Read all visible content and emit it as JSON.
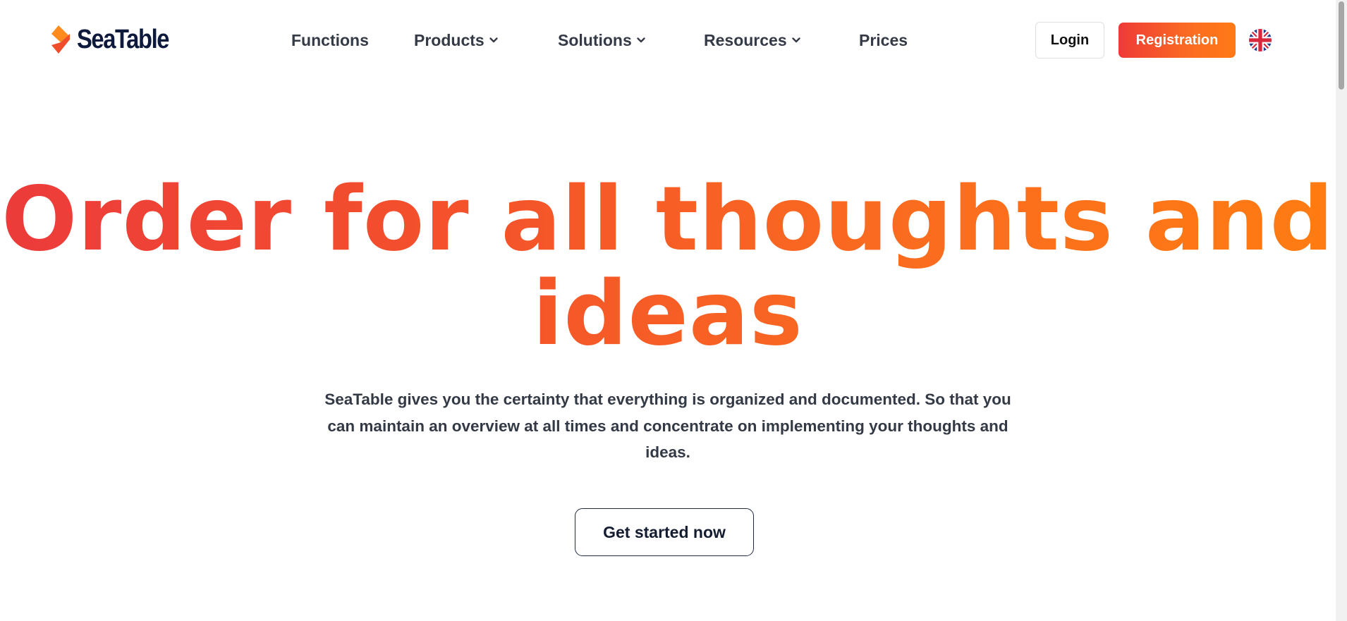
{
  "brand": {
    "name": "SeaTable",
    "colors": {
      "primary_gradient_start": "#ef3a36",
      "primary_gradient_end": "#ff7a16",
      "navy": "#0e1a3c",
      "text": "#343a46"
    }
  },
  "nav": {
    "items": [
      {
        "label": "Functions",
        "has_dropdown": false
      },
      {
        "label": "Products",
        "has_dropdown": true
      },
      {
        "label": "Solutions",
        "has_dropdown": true
      },
      {
        "label": "Resources",
        "has_dropdown": true
      },
      {
        "label": "Prices",
        "has_dropdown": false
      }
    ],
    "dropdown_icon": "chevron-down-icon"
  },
  "header_actions": {
    "login_label": "Login",
    "register_label": "Registration",
    "language_icon": "uk-flag-icon"
  },
  "hero": {
    "title_line1": "Order for all thoughts and",
    "title_line2": "ideas",
    "subtitle": "SeaTable gives you the certainty that everything is organized and documented. So that you can maintain an overview at all times and concentrate on implementing your thoughts and ideas.",
    "cta_label": "Get started now"
  }
}
